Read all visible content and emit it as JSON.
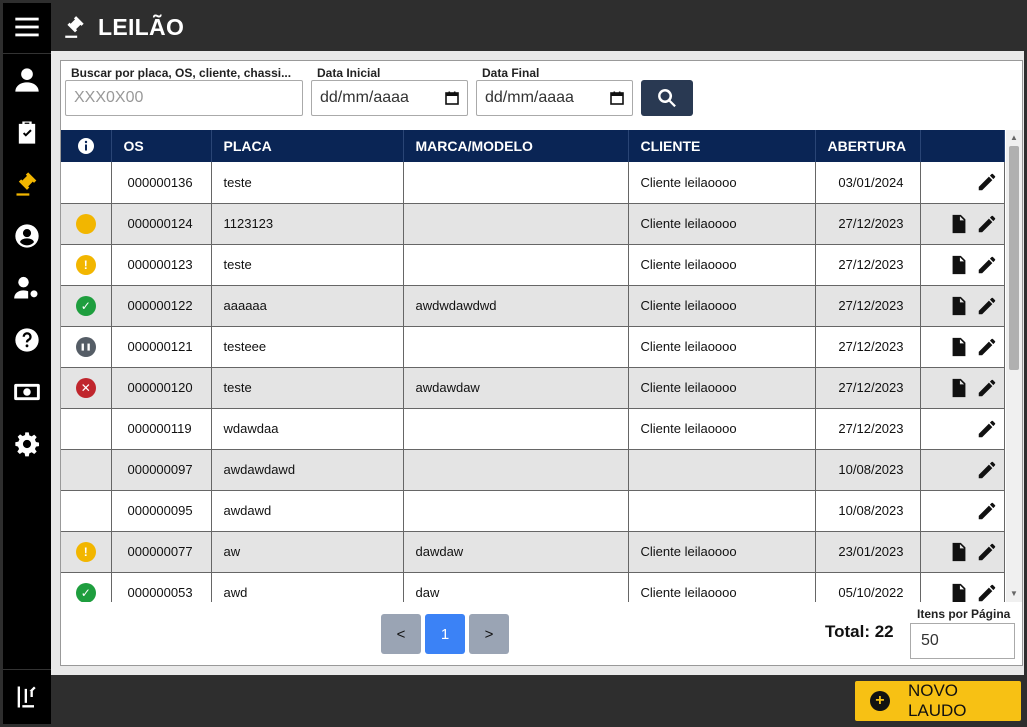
{
  "header": {
    "title": "LEILÃO"
  },
  "sidebar": {
    "items": [
      {
        "name": "menu"
      },
      {
        "name": "user"
      },
      {
        "name": "checklist"
      },
      {
        "name": "leilao",
        "active": true
      },
      {
        "name": "account"
      },
      {
        "name": "user-settings"
      },
      {
        "name": "help"
      },
      {
        "name": "money"
      },
      {
        "name": "settings"
      },
      {
        "name": "logout"
      }
    ]
  },
  "filters": {
    "search_label": "Buscar por placa, OS, cliente, chassi...",
    "search_placeholder": "XXX0X00",
    "start_label": "Data Inicial",
    "start_placeholder": "dd/mm/aaaa",
    "end_label": "Data Final",
    "end_placeholder": "dd/mm/aaaa"
  },
  "table": {
    "columns": [
      "OS",
      "PLACA",
      "MARCA/MODELO",
      "CLIENTE",
      "ABERTURA"
    ],
    "rows": [
      {
        "status": "none",
        "os": "000000136",
        "placa": "teste",
        "modelo": "",
        "cliente": "Cliente leilaoooo",
        "abertura": "03/01/2024",
        "doc": false
      },
      {
        "status": "pending",
        "os": "000000124",
        "placa": "1123123",
        "modelo": "",
        "cliente": "Cliente leilaoooo",
        "abertura": "27/12/2023",
        "doc": true
      },
      {
        "status": "warning",
        "os": "000000123",
        "placa": "teste",
        "modelo": "",
        "cliente": "Cliente leilaoooo",
        "abertura": "27/12/2023",
        "doc": true
      },
      {
        "status": "ok",
        "os": "000000122",
        "placa": "aaaaaa",
        "modelo": "awdwdawdwd",
        "cliente": "Cliente leilaoooo",
        "abertura": "27/12/2023",
        "doc": true
      },
      {
        "status": "paused",
        "os": "000000121",
        "placa": "testeee",
        "modelo": "",
        "cliente": "Cliente leilaoooo",
        "abertura": "27/12/2023",
        "doc": true
      },
      {
        "status": "error",
        "os": "000000120",
        "placa": "teste",
        "modelo": "awdawdaw",
        "cliente": "Cliente leilaoooo",
        "abertura": "27/12/2023",
        "doc": true
      },
      {
        "status": "none",
        "os": "000000119",
        "placa": "wdawdaa",
        "modelo": "",
        "cliente": "Cliente leilaoooo",
        "abertura": "27/12/2023",
        "doc": false
      },
      {
        "status": "none",
        "os": "000000097",
        "placa": "awdawdawd",
        "modelo": "",
        "cliente": "",
        "abertura": "10/08/2023",
        "doc": false
      },
      {
        "status": "none",
        "os": "000000095",
        "placa": "awdawd",
        "modelo": "",
        "cliente": "",
        "abertura": "10/08/2023",
        "doc": false
      },
      {
        "status": "warning",
        "os": "000000077",
        "placa": "aw",
        "modelo": "dawdaw",
        "cliente": "Cliente leilaoooo",
        "abertura": "23/01/2023",
        "doc": true
      },
      {
        "status": "ok",
        "os": "000000053",
        "placa": "awd",
        "modelo": "daw",
        "cliente": "Cliente leilaoooo",
        "abertura": "05/10/2022",
        "doc": true
      }
    ]
  },
  "status_colors": {
    "pending": "#f2b600",
    "warning": "#f2b600",
    "ok": "#1e9e3e",
    "paused": "#555d66",
    "error": "#c0262d"
  },
  "pagination": {
    "prev": "<",
    "current": "1",
    "next": ">",
    "total": "Total: 22",
    "per_page_label": "Itens por Página",
    "per_page_value": "50"
  },
  "footer": {
    "new_button": "NOVO LAUDO"
  }
}
